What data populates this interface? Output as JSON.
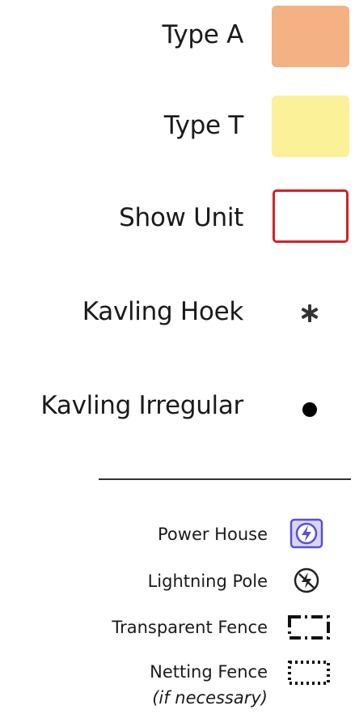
{
  "legend": {
    "main": [
      {
        "label": "Type A",
        "kind": "fill",
        "color": "#f4b183"
      },
      {
        "label": "Type T",
        "kind": "fill",
        "color": "#fbf199"
      },
      {
        "label": "Show Unit",
        "kind": "outline",
        "color": "#d81f26"
      },
      {
        "label": "Kavling Hoek",
        "kind": "star",
        "color": "#333333"
      },
      {
        "label": "Kavling Irregular",
        "kind": "dot",
        "color": "#000000"
      }
    ],
    "symbols": [
      {
        "label": "Power House",
        "icon": "power-house-icon",
        "color": "#5b4fcf"
      },
      {
        "label": "Lightning Pole",
        "icon": "lightning-pole-icon",
        "color": "#222222"
      },
      {
        "label": "Transparent Fence",
        "icon": "transparent-fence-icon",
        "color": "#111111"
      },
      {
        "label": "Netting Fence",
        "note": "(if necessary)",
        "icon": "netting-fence-icon",
        "color": "#111111"
      }
    ]
  }
}
